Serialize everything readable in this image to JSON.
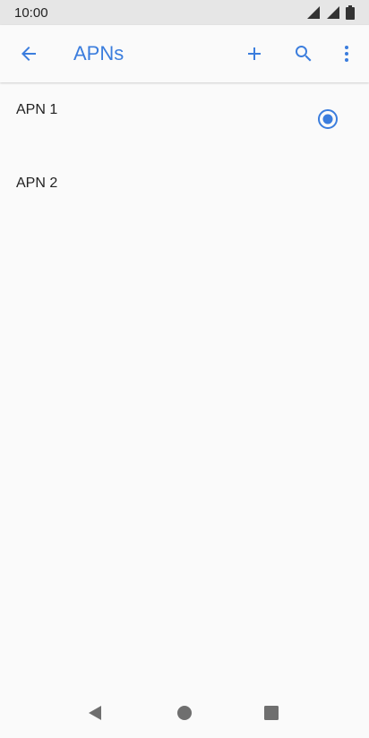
{
  "status_bar": {
    "time": "10:00",
    "icons": [
      "signal-icon",
      "signal-icon",
      "battery-icon"
    ]
  },
  "app_bar": {
    "title": "APNs",
    "back_icon": "arrow-back-icon",
    "actions": [
      "add-icon",
      "search-icon",
      "more-vert-icon"
    ]
  },
  "apns": {
    "items": [
      {
        "name": "APN 1",
        "selected": true
      },
      {
        "name": "APN 2",
        "selected": false
      }
    ]
  },
  "nav_bar": {
    "buttons": [
      "back-triangle-icon",
      "home-circle-icon",
      "recents-square-icon"
    ]
  },
  "colors": {
    "accent": "#3b7ddd",
    "status_bar": "#e6e6e6",
    "background": "#fafafa",
    "nav_icon": "#6f6f6f"
  }
}
